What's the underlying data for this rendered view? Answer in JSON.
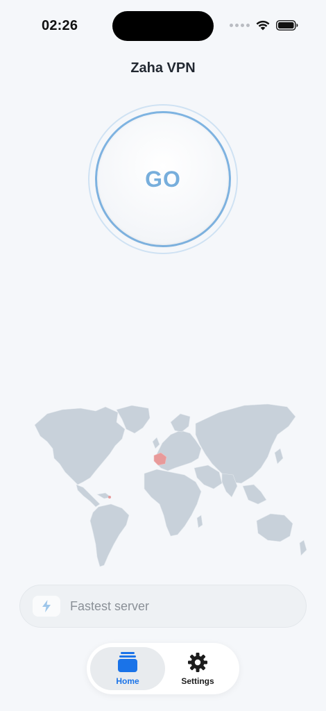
{
  "status_bar": {
    "time": "02:26"
  },
  "header": {
    "title": "Zaha VPN"
  },
  "connect_button": {
    "label": "GO",
    "accent_color": "#77aedc"
  },
  "server_selector": {
    "label": "Fastest server",
    "icon": "lightning-bolt-icon"
  },
  "tabs": [
    {
      "label": "Home",
      "icon": "home-icon",
      "active": true,
      "color": "#1a73e8"
    },
    {
      "label": "Settings",
      "icon": "gear-icon",
      "active": false,
      "color": "#1c1c1c"
    }
  ],
  "colors": {
    "background": "#f5f7fa",
    "map_land": "#c8d1da",
    "map_highlight": "#e89a9a"
  }
}
